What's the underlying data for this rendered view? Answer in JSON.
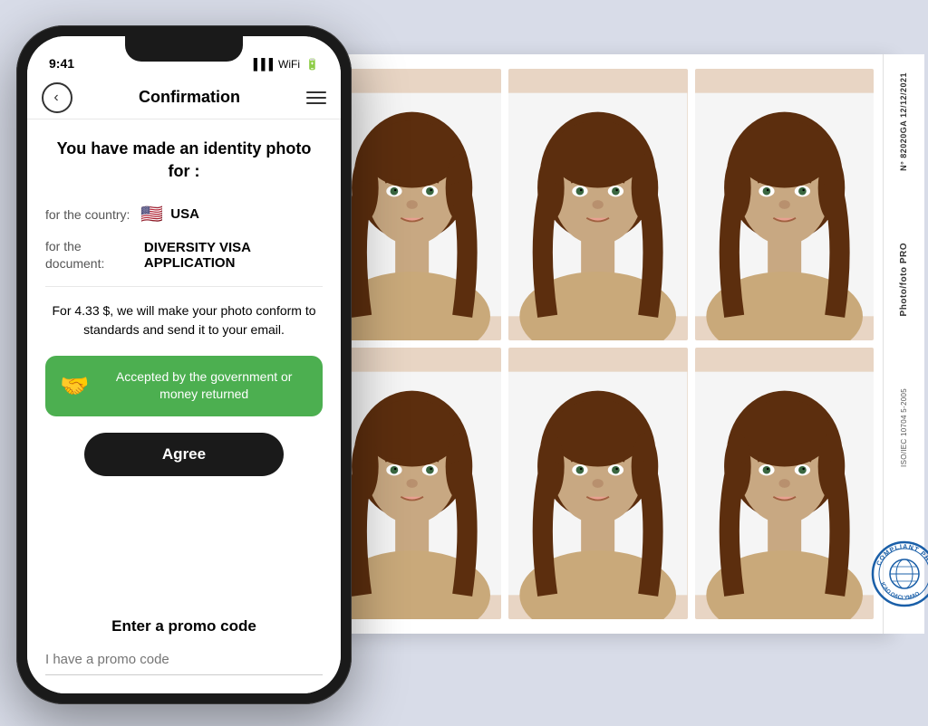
{
  "background_color": "#d8dce8",
  "phone": {
    "nav": {
      "back_label": "‹",
      "title": "Confirmation",
      "menu_label": "≡"
    },
    "screen": {
      "headline": "You have made an identity photo for :",
      "country_label": "for the country:",
      "country_value": "USA",
      "country_flag": "🇺🇸",
      "document_label": "for the document:",
      "document_value": "DIVERSITY VISA APPLICATION",
      "price_text": "For 4.33 $, we will make your photo conform to standards and send it to your email.",
      "guarantee_text": "Accepted by the government or money returned",
      "guarantee_icon": "🤝",
      "agree_button_label": "Agree",
      "promo_section_title": "Enter a promo code",
      "promo_placeholder": "I have a promo code"
    }
  },
  "photo_sheet": {
    "side_label_top": "N° 82020GA\n12/12/2021",
    "side_label_mid": "Photo/foto PRO",
    "side_label_iso": "ISO/IEC 10704 5-2005",
    "stamp_text": "COMPLIANT PHOTOS",
    "stamp_sub": "ICAO OACI YMAO"
  },
  "colors": {
    "green": "#4caf50",
    "dark": "#1a1a1a",
    "blue_stamp": "#1a5fa8",
    "skin": "#c8a882",
    "hair": "#5c2e0e",
    "shirt": "#c9a97a",
    "bg_photo": "#f0f0f0"
  }
}
